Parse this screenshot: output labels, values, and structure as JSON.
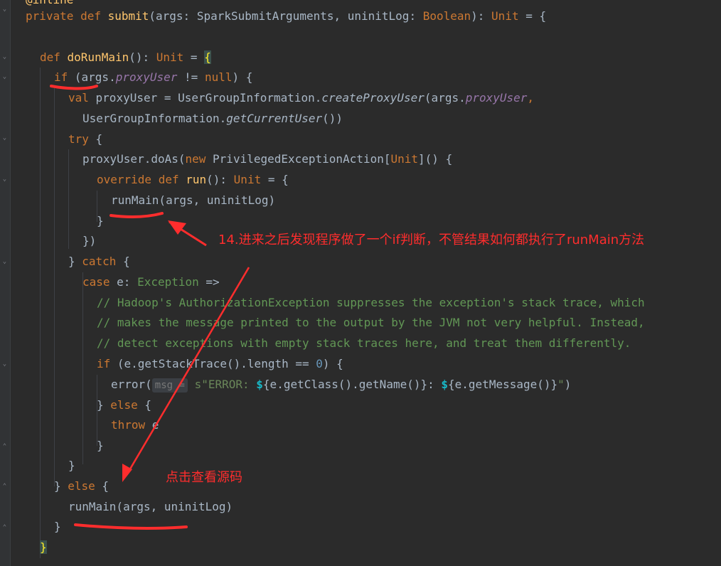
{
  "code": {
    "line0": "@inline",
    "sig": {
      "kw_private": "private ",
      "kw_def": "def ",
      "fn": "submit",
      "p1": "(args: SparkSubmitArguments, uninitLog: ",
      "bool": "Boolean",
      "p2": "): ",
      "unit": "Unit",
      "p3": " = {"
    },
    "dorun": {
      "kw_def": "def ",
      "fn": "doRunMain",
      "p1": "(): ",
      "unit": "Unit",
      "p2": " = ",
      "brace": "{"
    },
    "if1": {
      "kw": "if",
      "p1": " (args.",
      "prop": "proxyUser",
      "p2": " != ",
      "null": "null",
      "p3": ") {"
    },
    "val": {
      "kw": "val",
      "p1": " proxyUser = UserGroupInformation.",
      "m": "createProxyUser",
      "p2": "(args.",
      "prop": "proxyUser",
      "p3": ","
    },
    "ugi": {
      "p1": "UserGroupInformation.",
      "m": "getCurrentUser",
      "p2": "())"
    },
    "try": {
      "kw": "try",
      "p1": " {"
    },
    "doas": {
      "p1": "proxyUser.doAs(",
      "kw": "new",
      "p2": " PrivilegedExceptionAction[",
      "unit": "Unit",
      "p3": "]() {"
    },
    "override": {
      "kw1": "override ",
      "kw2": "def ",
      "fn": "run",
      "p1": "(): ",
      "unit": "Unit",
      "p2": " = {"
    },
    "runmain1": "runMain(args, uninitLog)",
    "close1": "}",
    "close2": "})",
    "catch": {
      "p1": "} ",
      "kw": "catch",
      "p2": " {"
    },
    "case": {
      "kw": "case",
      "p1": " e: ",
      "exc": "Exception",
      "p2": " =>"
    },
    "cmt1": "// Hadoop's AuthorizationException suppresses the exception's stack trace, which",
    "cmt2": "// makes the message printed to the output by the JVM not very helpful. Instead,",
    "cmt3": "// detect exceptions with empty stack traces here, and treat them differently.",
    "if2": {
      "kw": "if",
      "p1": " (e.getStackTrace().length == ",
      "num": "0",
      "p2": ") {"
    },
    "error": {
      "p1": "error(",
      "hint": "msg =",
      "s": " s\"ERROR: ",
      "d1": "$",
      "p2": "{e.getClass().getName()}: ",
      "d2": "$",
      "p3": "{e.getMessage()}",
      "q": "\"",
      "p4": ")"
    },
    "else1": {
      "p1": "} ",
      "kw": "else",
      "p2": " {"
    },
    "throw": {
      "kw": "throw",
      "p1": " e"
    },
    "close3": "}",
    "close4": "}",
    "else2": {
      "p1": "} ",
      "kw": "else",
      "p2": " {"
    },
    "runmain2": "runMain(args, uninitLog)",
    "close5": "}",
    "close6": "}"
  },
  "annotations": {
    "note14": "14.进来之后发现程序做了一个if判断，不管结果如何都执行了runMain方法",
    "note_click": "点击查看源码"
  },
  "colors": {
    "annotation": "#ff2d2d",
    "keyword": "#cc7832",
    "function": "#ffc66d",
    "comment": "#629755",
    "background": "#2b2b2b"
  }
}
